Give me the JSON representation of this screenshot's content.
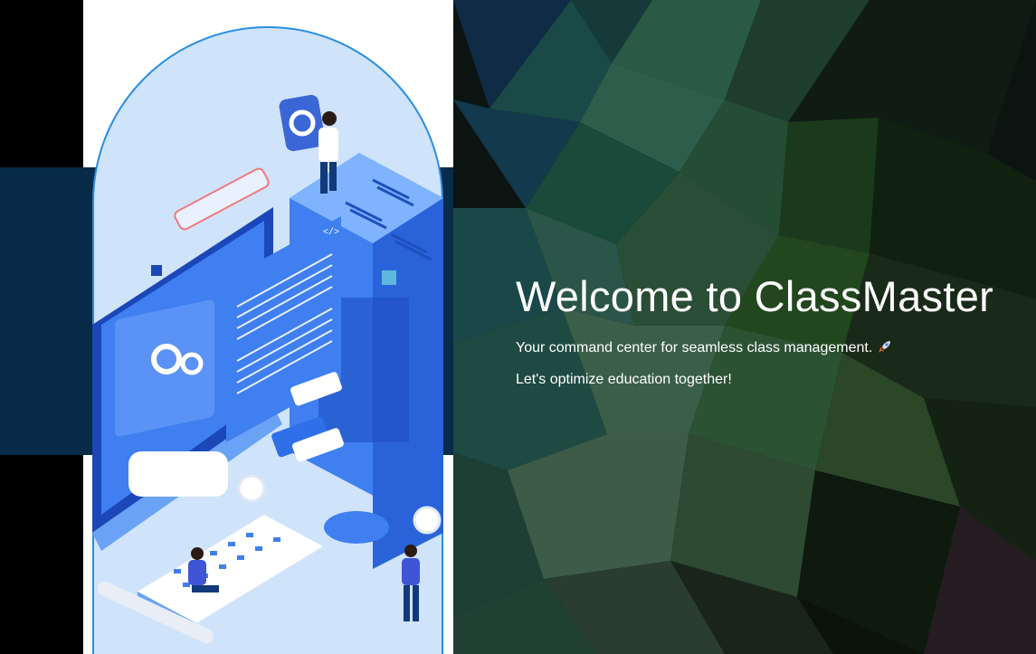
{
  "hero": {
    "title": "Welcome to ClassMaster",
    "subtitle": "Your command center for seamless class management.",
    "subtitle_emoji_icon": "rocket-icon",
    "tagline": "Let's optimize education together!"
  },
  "colors": {
    "navy_band": "#082b49",
    "illustration_border": "#2a8ee0",
    "illustration_bg": "#cfe3fb",
    "text": "#ffffff"
  },
  "illustration": {
    "icon_names": [
      "server-rack-icon",
      "monitor-icon",
      "keyboard-icon",
      "mouse-icon",
      "gear-icon",
      "person-icon",
      "code-window-icon",
      "chat-bubble-icon"
    ]
  }
}
